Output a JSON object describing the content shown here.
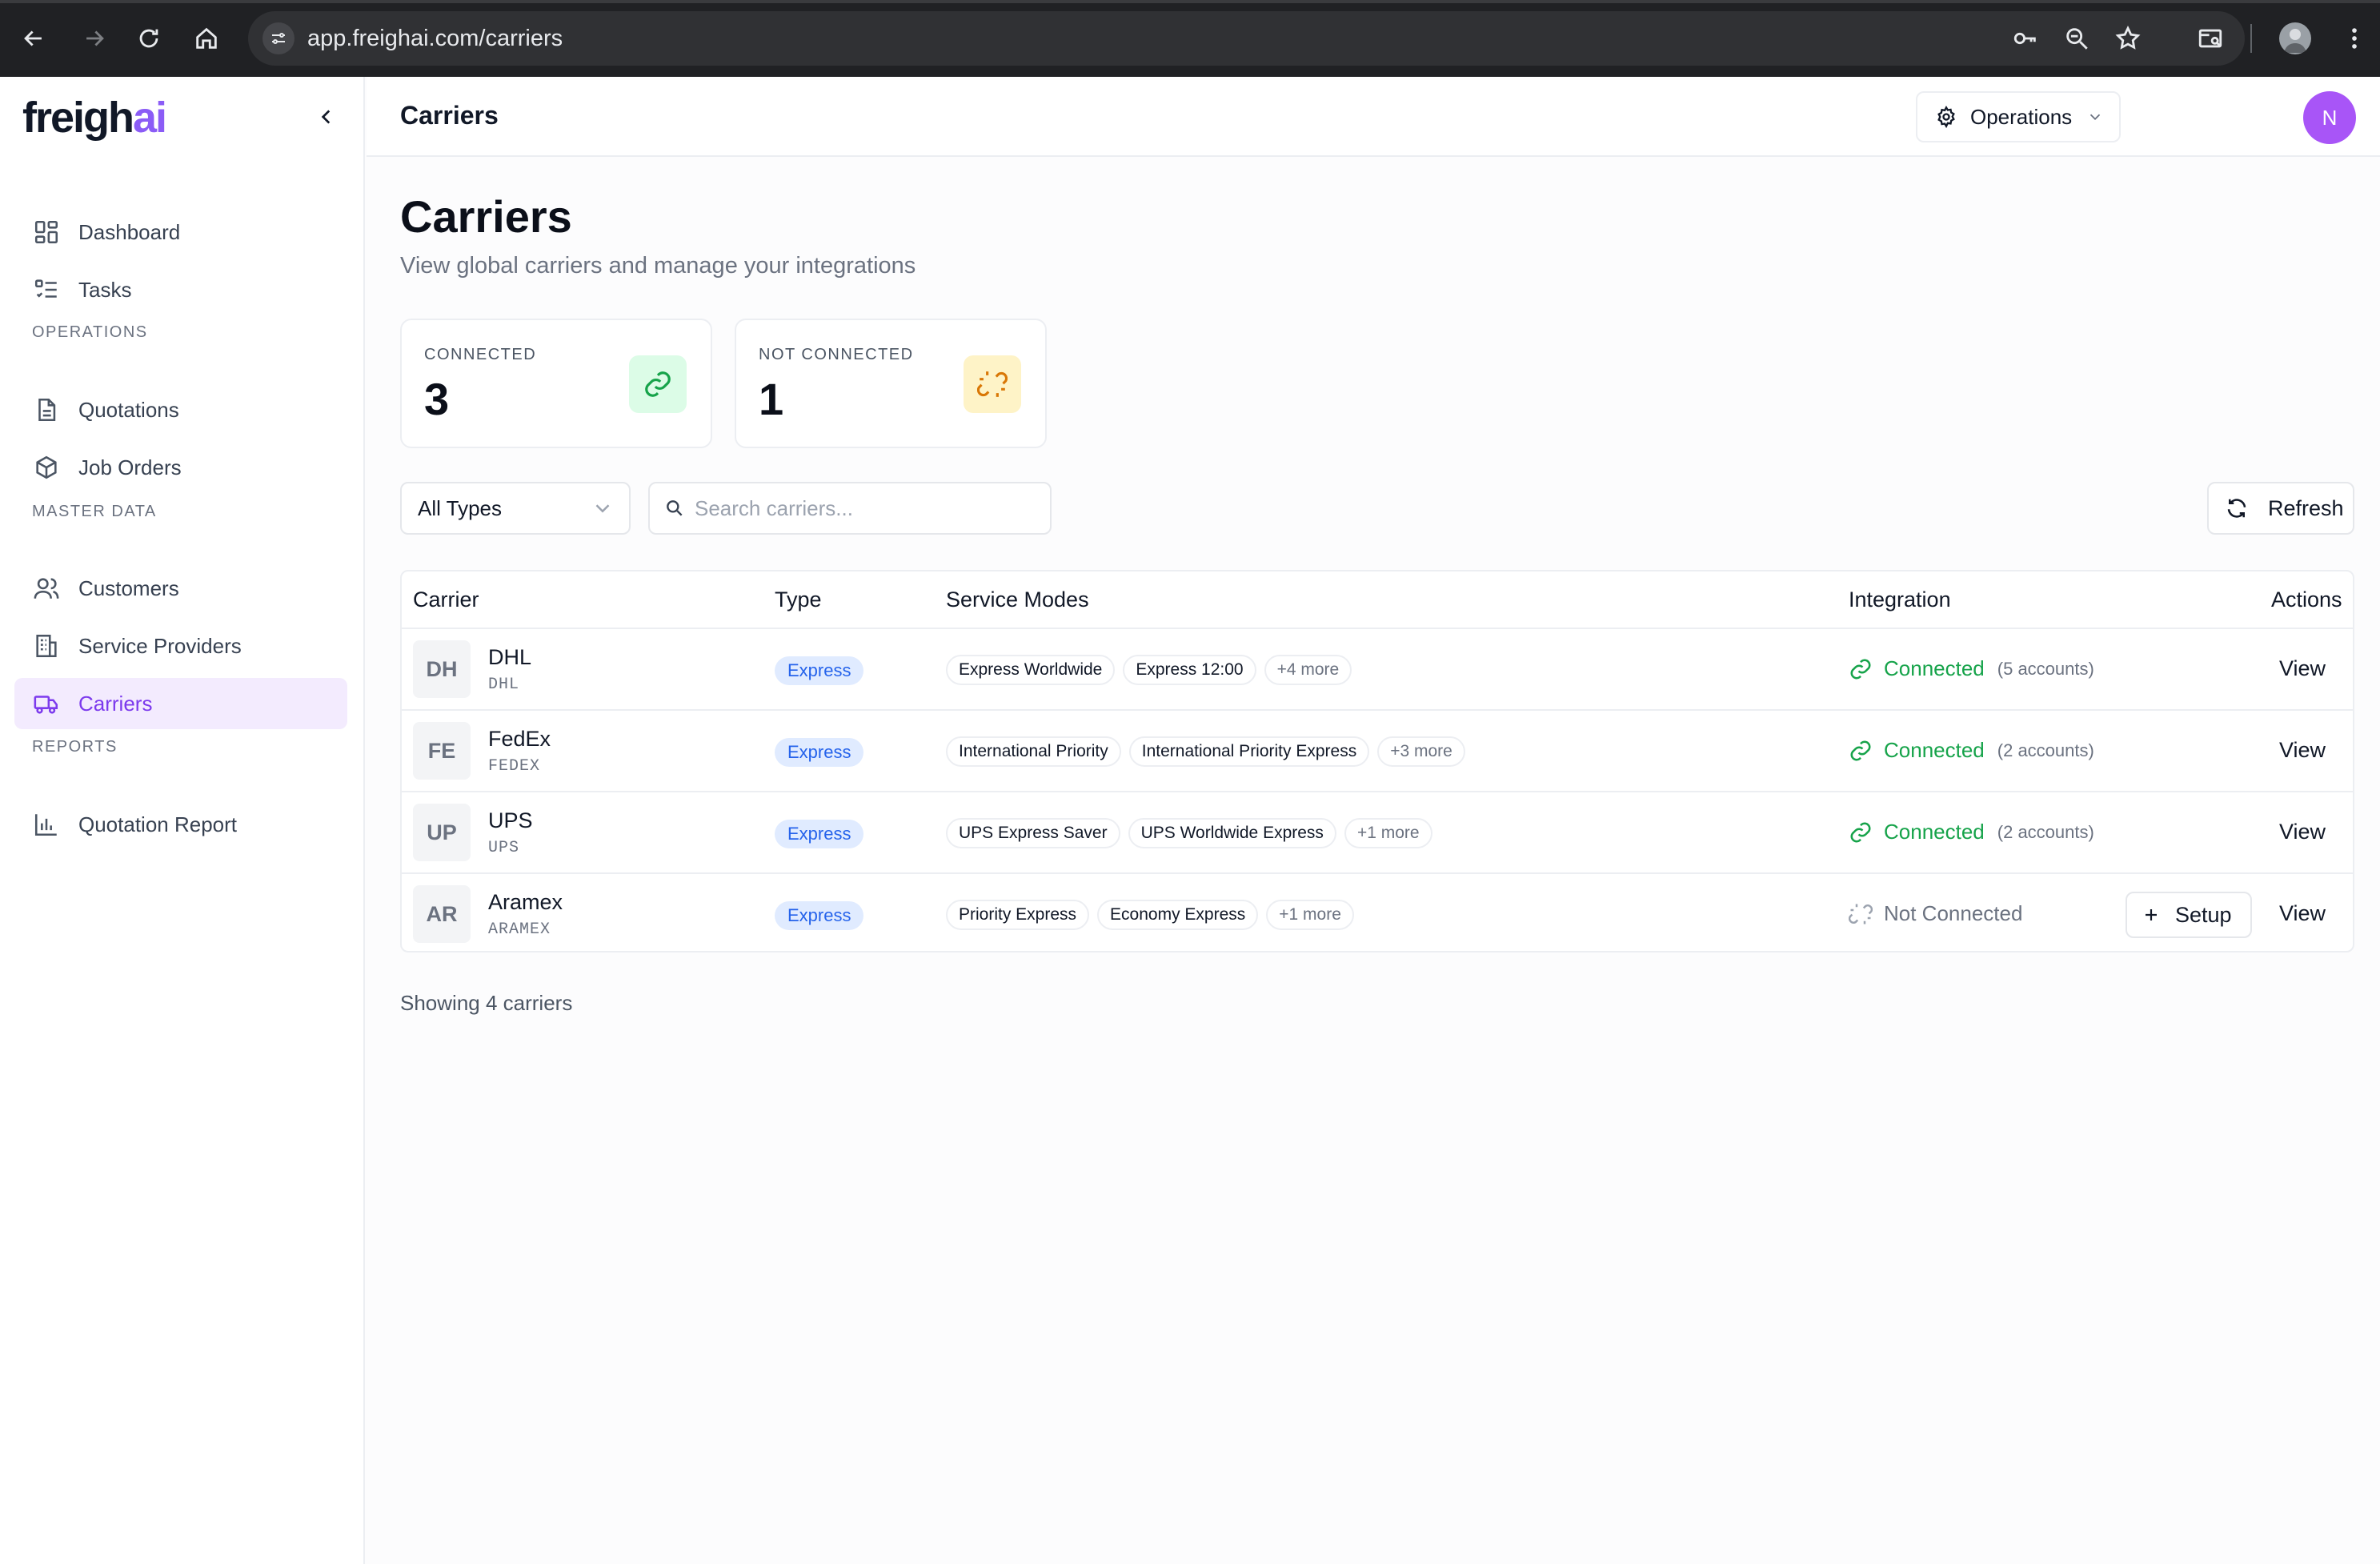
{
  "browser": {
    "url": "app.freighai.com/carriers"
  },
  "sidebar": {
    "logo_main": "freigh",
    "logo_accent": "ai",
    "items_top": [
      {
        "label": "Dashboard",
        "icon": "dashboard-icon"
      },
      {
        "label": "Tasks",
        "icon": "tasks-icon"
      }
    ],
    "sections": {
      "operations": "OPERATIONS",
      "master_data": "MASTER DATA",
      "reports": "REPORTS"
    },
    "operations_items": [
      {
        "label": "Quotations",
        "icon": "document-icon"
      },
      {
        "label": "Job Orders",
        "icon": "package-icon"
      }
    ],
    "master_items": [
      {
        "label": "Customers",
        "icon": "users-icon"
      },
      {
        "label": "Service Providers",
        "icon": "building-icon"
      },
      {
        "label": "Carriers",
        "icon": "truck-icon",
        "active": true
      }
    ],
    "report_items": [
      {
        "label": "Quotation Report",
        "icon": "bar-chart-icon"
      }
    ]
  },
  "header": {
    "title": "Carriers",
    "workspace": "Operations",
    "avatar_initial": "N"
  },
  "main": {
    "title": "Carriers",
    "subtitle": "View global carriers and manage your integrations",
    "stats": {
      "connected_label": "CONNECTED",
      "connected_value": "3",
      "not_connected_label": "NOT CONNECTED",
      "not_connected_value": "1"
    },
    "filters": {
      "type_value": "All Types",
      "search_placeholder": "Search carriers...",
      "refresh_label": "Refresh"
    },
    "table": {
      "columns": {
        "carrier": "Carrier",
        "type": "Type",
        "service_modes": "Service Modes",
        "integration": "Integration",
        "actions": "Actions"
      },
      "rows": [
        {
          "initials": "DH",
          "name": "DHL",
          "code": "DHL",
          "type": "Express",
          "modes": [
            "Express Worldwide",
            "Express 12:00"
          ],
          "more": "+4 more",
          "status": "Connected",
          "accounts": "(5 accounts)",
          "view": "View"
        },
        {
          "initials": "FE",
          "name": "FedEx",
          "code": "FEDEX",
          "type": "Express",
          "modes": [
            "International Priority",
            "International Priority Express"
          ],
          "more": "+3 more",
          "status": "Connected",
          "accounts": "(2 accounts)",
          "view": "View"
        },
        {
          "initials": "UP",
          "name": "UPS",
          "code": "UPS",
          "type": "Express",
          "modes": [
            "UPS Express Saver",
            "UPS Worldwide Express"
          ],
          "more": "+1 more",
          "status": "Connected",
          "accounts": "(2 accounts)",
          "view": "View"
        },
        {
          "initials": "AR",
          "name": "Aramex",
          "code": "ARAMEX",
          "type": "Express",
          "modes": [
            "Priority Express",
            "Economy Express"
          ],
          "more": "+1 more",
          "status": "Not Connected",
          "setup": "Setup",
          "view": "View"
        }
      ]
    },
    "footer": "Showing 4 carriers"
  },
  "colors": {
    "accent": "#8b5cf6",
    "connected": "#16a34a",
    "express_badge": "#2563eb"
  }
}
